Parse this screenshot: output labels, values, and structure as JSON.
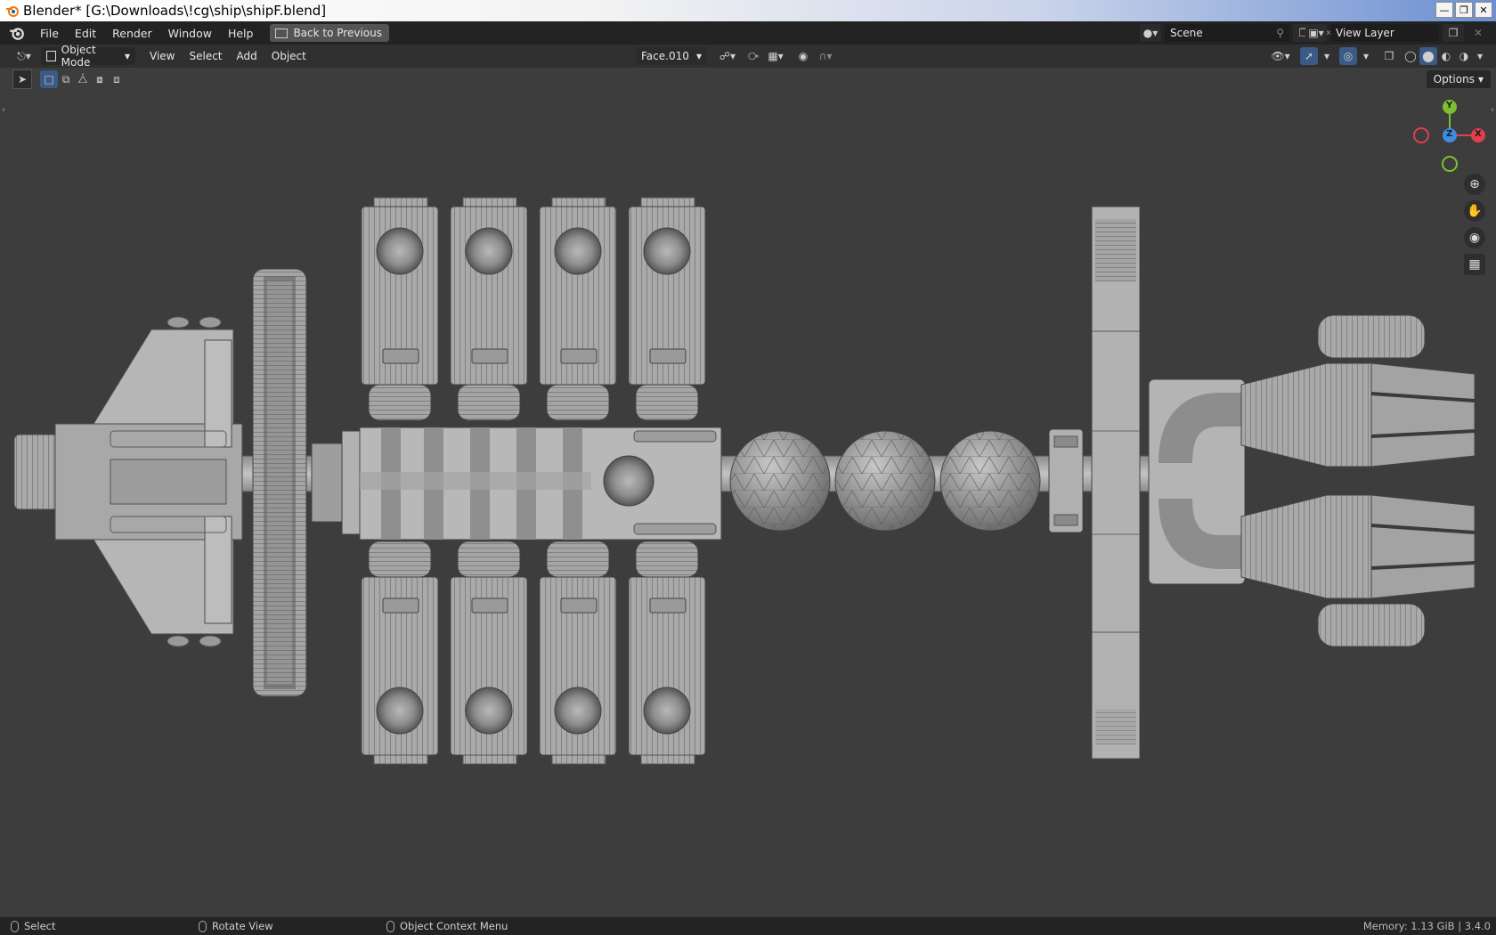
{
  "window": {
    "title": "Blender* [G:\\Downloads\\!cg\\ship\\shipF.blend]",
    "controls": [
      "minimize-icon",
      "restore-icon",
      "close-icon"
    ]
  },
  "menubar": {
    "items": [
      "File",
      "Edit",
      "Render",
      "Window",
      "Help"
    ],
    "back_button": "Back to Previous",
    "scene_label": "Scene",
    "view_layer_label": "View Layer"
  },
  "viewport_header": {
    "mode": "Object Mode",
    "menus": [
      "View",
      "Select",
      "Add",
      "Object"
    ],
    "active_object": "Face.010",
    "options_label": "Options"
  },
  "statusbar": {
    "select": "Select",
    "rotate": "Rotate View",
    "context": "Object Context Menu",
    "memory": "Memory: 1.13 GiB | 3.4.0"
  },
  "gizmo": {
    "x_label": "X",
    "y_label": "Y",
    "z_label": "Z",
    "x_color": "#e0404c",
    "y_color": "#7cbf2f",
    "z_color": "#3b8de0"
  },
  "colors": {
    "titlebar_end": "#6b8fd1",
    "viewport_bg": "#3d3d3d",
    "menubar_bg": "#232323",
    "header_bg": "#303030"
  }
}
